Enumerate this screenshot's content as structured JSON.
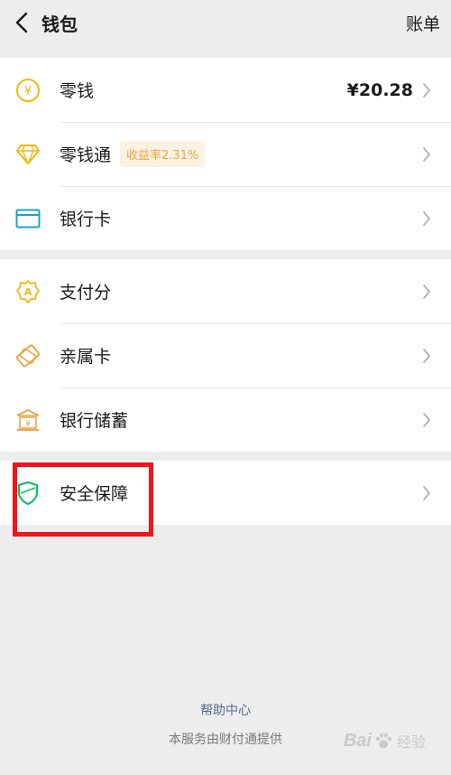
{
  "header": {
    "title": "钱包",
    "bill_label": "账单"
  },
  "groups": [
    {
      "items": [
        {
          "label": "零钱",
          "value": "¥20.28",
          "icon": "yuan-coin-icon"
        },
        {
          "label": "零钱通",
          "badge": "收益率2.31%",
          "icon": "diamond-icon"
        },
        {
          "label": "银行卡",
          "icon": "bank-card-icon"
        }
      ]
    },
    {
      "items": [
        {
          "label": "支付分",
          "icon": "pay-score-icon"
        },
        {
          "label": "亲属卡",
          "icon": "family-card-icon"
        },
        {
          "label": "银行储蓄",
          "icon": "bank-savings-icon"
        }
      ]
    },
    {
      "items": [
        {
          "label": "安全保障",
          "icon": "security-shield-icon"
        }
      ]
    }
  ],
  "footer": {
    "help_center": "帮助中心",
    "provider": "本服务由财付通提供"
  },
  "watermark": {
    "brand": "Bai",
    "suffix": "经验"
  },
  "colors": {
    "accent_yellow": "#f0b90b",
    "accent_cyan": "#1aa6c8",
    "accent_orange": "#e8a64a",
    "accent_green": "#07c160",
    "link_blue": "#576b95",
    "highlight_red": "#f5121b"
  }
}
